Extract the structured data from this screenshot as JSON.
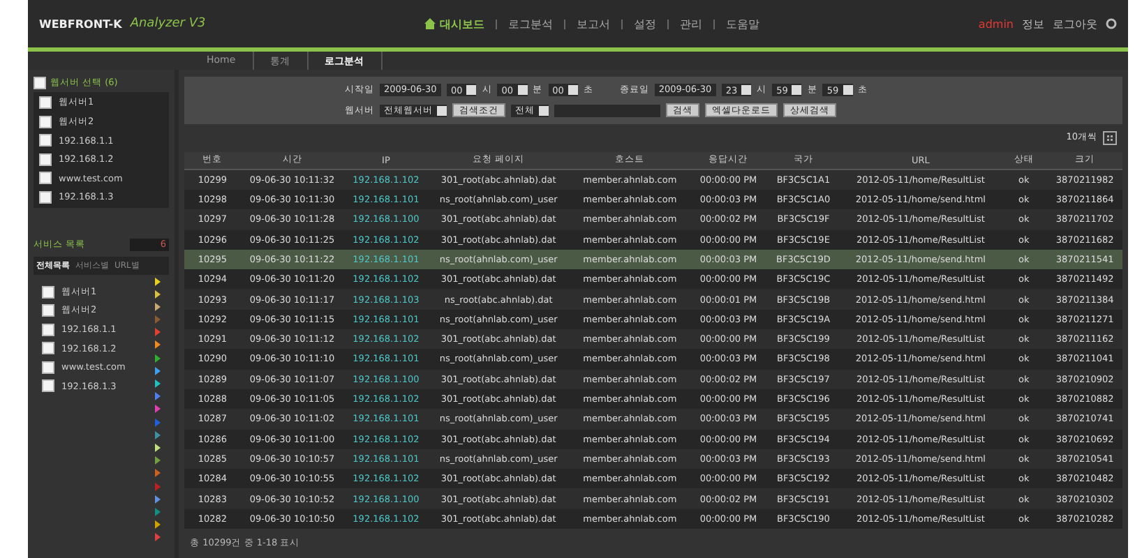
{
  "header": {
    "logo": "WEBFRONT-K",
    "product": "Analyzer V3",
    "nav": [
      {
        "label": "대시보드",
        "selected": true
      },
      {
        "label": "로그분석",
        "selected": false
      },
      {
        "label": "보고서",
        "selected": false
      },
      {
        "label": "설정",
        "selected": false
      },
      {
        "label": "관리",
        "selected": false
      },
      {
        "label": "도움말",
        "selected": false
      }
    ],
    "user": "admin",
    "user_links": [
      "정보",
      "로그아웃"
    ]
  },
  "tabs": [
    {
      "label": "Home",
      "selected": false
    },
    {
      "label": "통계",
      "selected": false
    },
    {
      "label": "로그분석",
      "selected": true
    }
  ],
  "sidebar": {
    "server_title": "웹서버 선택 (6)",
    "server_title_checked": false,
    "servers": [
      {
        "label": "웹서버1",
        "checked": false
      },
      {
        "label": "웹서버2",
        "checked": false
      },
      {
        "label": "192.168.1.1",
        "checked": false
      },
      {
        "label": "192.168.1.2",
        "checked": false
      },
      {
        "label": "www.test.com",
        "checked": false
      },
      {
        "label": "192.168.1.3",
        "checked": false
      }
    ],
    "service_title": "서비스 목록",
    "service_count": "6",
    "service_tabs": [
      {
        "label": "전체목록",
        "selected": true
      },
      {
        "label": "서비스별",
        "selected": false
      },
      {
        "label": "URL별",
        "selected": false
      }
    ],
    "services": [
      {
        "label": "웹서버1",
        "checked": false
      },
      {
        "label": "웹서버2",
        "checked": false
      },
      {
        "label": "192.168.1.1",
        "checked": false
      },
      {
        "label": "192.168.1.2",
        "checked": false
      },
      {
        "label": "www.test.com",
        "checked": false
      },
      {
        "label": "192.168.1.3",
        "checked": false
      }
    ],
    "markers": [
      {
        "color": "#e8d020"
      },
      {
        "color": "#d8c040"
      },
      {
        "color": "#c8a870"
      },
      {
        "color": "#8a5a30"
      },
      {
        "color": "#e04030"
      },
      {
        "color": "#f08a20"
      },
      {
        "color": "#30b030"
      },
      {
        "color": "#40a0f0"
      },
      {
        "color": "#20c0c0"
      },
      {
        "color": "#5080f0"
      },
      {
        "color": "#e040b0"
      },
      {
        "color": "#2060e0"
      },
      {
        "color": "#4090a0"
      },
      {
        "color": "#c0e080"
      },
      {
        "color": "#70a040"
      },
      {
        "color": "#d06020"
      },
      {
        "color": "#c02020"
      },
      {
        "color": "#6090e0"
      },
      {
        "color": "#109080"
      },
      {
        "color": "#d0a000"
      },
      {
        "color": "#e04040"
      }
    ]
  },
  "filter": {
    "ranges": [
      {
        "label": "시작일",
        "date": "2009-06-30",
        "hour": "00",
        "hour_unit": "시",
        "min": "00",
        "min_unit": "분",
        "sec": "00",
        "sec_unit": "초"
      },
      {
        "label": "종료일",
        "date": "2009-06-30",
        "hour": "23",
        "hour_unit": "시",
        "min": "59",
        "min_unit": "분",
        "sec": "59",
        "sec_unit": "초"
      }
    ],
    "server_label": "웹서버",
    "server_value": "전체웹서버",
    "condition_button": "검색조건",
    "condition_value": "전체",
    "buttons": [
      "검색",
      "엑셀다운로드",
      "상세검색"
    ],
    "page_size": "10개씩"
  },
  "table": {
    "columns": [
      "번호",
      "시간",
      "IP",
      "요청 페이지",
      "호스트",
      "응답시간",
      "국가",
      "URL",
      "상태",
      "크기"
    ],
    "rows": [
      {
        "selected": false,
        "cells": [
          "10299",
          "09-06-30 10:11:32",
          "192.168.1.102",
          "301_root(abc.ahnlab).dat",
          "member.ahnlab.com",
          "00:00:00 PM",
          "BF3C5C1A1",
          "2012-05-11/home/ResultList",
          "ok",
          "3870211982"
        ]
      },
      {
        "selected": false,
        "cells": [
          "10298",
          "09-06-30 10:11:30",
          "192.168.1.101",
          "ns_root(ahnlab.com)_user",
          "member.ahnlab.com",
          "00:00:03 PM",
          "BF3C5C1A0",
          "2012-05-11/home/send.html",
          "ok",
          "3870211864"
        ]
      },
      {
        "selected": false,
        "cells": [
          "10297",
          "09-06-30 10:11:28",
          "192.168.1.100",
          "301_root(abc.ahnlab).dat",
          "member.ahnlab.com",
          "00:00:02 PM",
          "BF3C5C19F",
          "2012-05-11/home/ResultList",
          "ok",
          "3870211702"
        ]
      },
      {
        "selected": false,
        "cells": [
          "10296",
          "09-06-30 10:11:25",
          "192.168.1.102",
          "301_root(abc.ahnlab).dat",
          "member.ahnlab.com",
          "00:00:00 PM",
          "BF3C5C19E",
          "2012-05-11/home/ResultList",
          "ok",
          "3870211682"
        ]
      },
      {
        "selected": true,
        "cells": [
          "10295",
          "09-06-30 10:11:22",
          "192.168.1.101",
          "ns_root(ahnlab.com)_user",
          "member.ahnlab.com",
          "00:00:03 PM",
          "BF3C5C19D",
          "2012-05-11/home/send.html",
          "ok",
          "3870211541"
        ]
      },
      {
        "selected": false,
        "cells": [
          "10294",
          "09-06-30 10:11:20",
          "192.168.1.102",
          "301_root(abc.ahnlab).dat",
          "member.ahnlab.com",
          "00:00:00 PM",
          "BF3C5C19C",
          "2012-05-11/home/ResultList",
          "ok",
          "3870211492"
        ]
      },
      {
        "selected": false,
        "cells": [
          "10293",
          "09-06-30 10:11:17",
          "192.168.1.103",
          "ns_root(abc.ahnlab).dat",
          "member.ahnlab.com",
          "00:00:01 PM",
          "BF3C5C19B",
          "2012-05-11/home/send.html",
          "ok",
          "3870211384"
        ]
      },
      {
        "selected": false,
        "cells": [
          "10292",
          "09-06-30 10:11:15",
          "192.168.1.101",
          "ns_root(ahnlab.com)_user",
          "member.ahnlab.com",
          "00:00:03 PM",
          "BF3C5C19A",
          "2012-05-11/home/send.html",
          "ok",
          "3870211271"
        ]
      },
      {
        "selected": false,
        "cells": [
          "10291",
          "09-06-30 10:11:12",
          "192.168.1.102",
          "301_root(abc.ahnlab).dat",
          "member.ahnlab.com",
          "00:00:00 PM",
          "BF3C5C199",
          "2012-05-11/home/ResultList",
          "ok",
          "3870211162"
        ]
      },
      {
        "selected": false,
        "cells": [
          "10290",
          "09-06-30 10:11:10",
          "192.168.1.101",
          "ns_root(ahnlab.com)_user",
          "member.ahnlab.com",
          "00:00:03 PM",
          "BF3C5C198",
          "2012-05-11/home/send.html",
          "ok",
          "3870211041"
        ]
      },
      {
        "selected": false,
        "cells": [
          "10289",
          "09-06-30 10:11:07",
          "192.168.1.100",
          "301_root(abc.ahnlab).dat",
          "member.ahnlab.com",
          "00:00:02 PM",
          "BF3C5C197",
          "2012-05-11/home/ResultList",
          "ok",
          "3870210902"
        ]
      },
      {
        "selected": false,
        "cells": [
          "10288",
          "09-06-30 10:11:05",
          "192.168.1.102",
          "301_root(abc.ahnlab).dat",
          "member.ahnlab.com",
          "00:00:00 PM",
          "BF3C5C196",
          "2012-05-11/home/ResultList",
          "ok",
          "3870210882"
        ]
      },
      {
        "selected": false,
        "cells": [
          "10287",
          "09-06-30 10:11:02",
          "192.168.1.101",
          "ns_root(ahnlab.com)_user",
          "member.ahnlab.com",
          "00:00:03 PM",
          "BF3C5C195",
          "2012-05-11/home/send.html",
          "ok",
          "3870210741"
        ]
      },
      {
        "selected": false,
        "cells": [
          "10286",
          "09-06-30 10:11:00",
          "192.168.1.102",
          "301_root(abc.ahnlab).dat",
          "member.ahnlab.com",
          "00:00:00 PM",
          "BF3C5C194",
          "2012-05-11/home/ResultList",
          "ok",
          "3870210692"
        ]
      },
      {
        "selected": false,
        "cells": [
          "10285",
          "09-06-30 10:10:57",
          "192.168.1.101",
          "ns_root(ahnlab.com)_user",
          "member.ahnlab.com",
          "00:00:03 PM",
          "BF3C5C193",
          "2012-05-11/home/send.html",
          "ok",
          "3870210541"
        ]
      },
      {
        "selected": false,
        "cells": [
          "10284",
          "09-06-30 10:10:55",
          "192.168.1.102",
          "301_root(abc.ahnlab).dat",
          "member.ahnlab.com",
          "00:00:00 PM",
          "BF3C5C192",
          "2012-05-11/home/ResultList",
          "ok",
          "3870210482"
        ]
      },
      {
        "selected": false,
        "cells": [
          "10283",
          "09-06-30 10:10:52",
          "192.168.1.100",
          "301_root(abc.ahnlab).dat",
          "member.ahnlab.com",
          "00:00:02 PM",
          "BF3C5C191",
          "2012-05-11/home/ResultList",
          "ok",
          "3870210302"
        ]
      },
      {
        "selected": false,
        "cells": [
          "10282",
          "09-06-30 10:10:50",
          "192.168.1.102",
          "301_root(abc.ahnlab).dat",
          "member.ahnlab.com",
          "00:00:00 PM",
          "BF3C5C190",
          "2012-05-11/home/ResultList",
          "ok",
          "3870210282"
        ]
      }
    ]
  },
  "footer": "총 10299건 중 1-18 표시"
}
